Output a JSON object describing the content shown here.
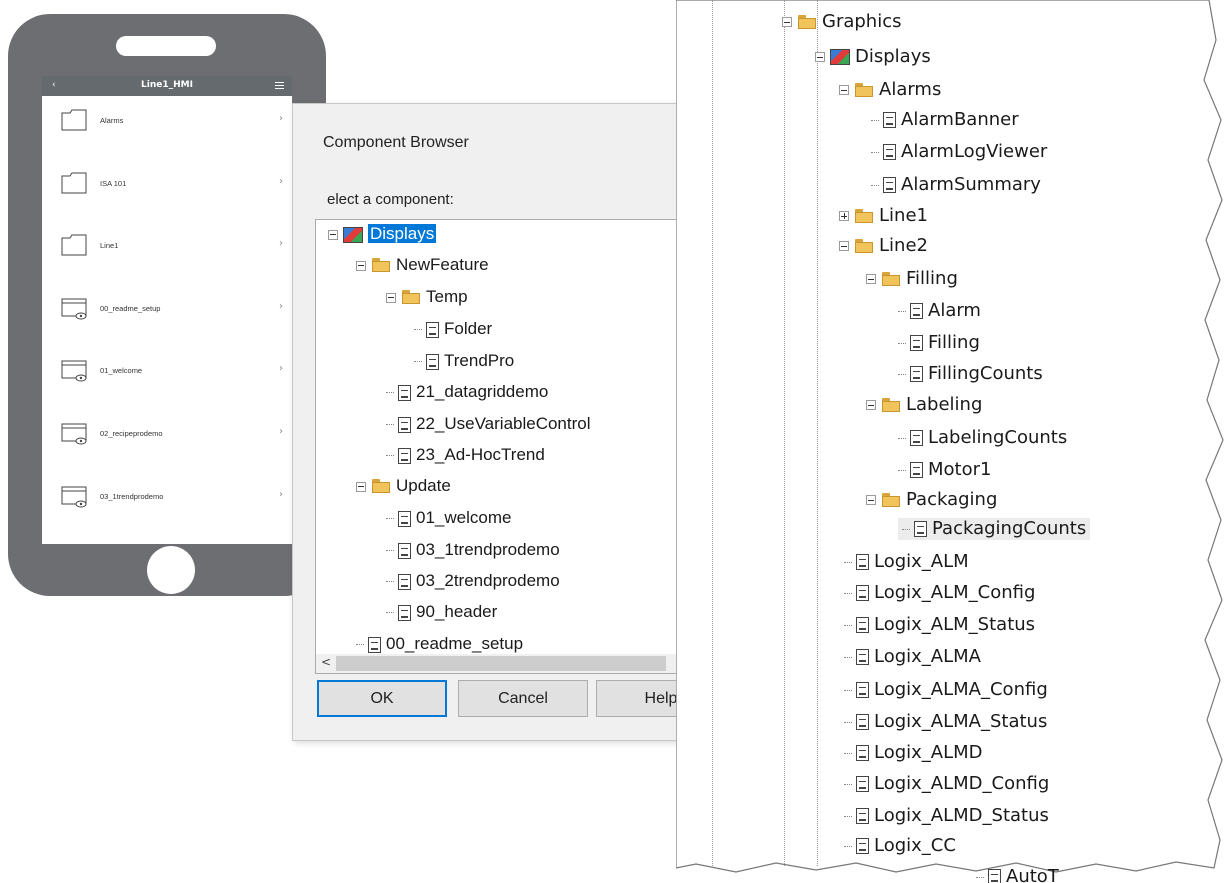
{
  "phone": {
    "back": "‹",
    "title": "Line1_HMI",
    "items": [
      {
        "label": "Alarms",
        "icon": "folder-icon"
      },
      {
        "label": "ISA 101",
        "icon": "folder-icon"
      },
      {
        "label": "Line1",
        "icon": "folder-icon"
      },
      {
        "label": "00_readme_setup",
        "icon": "display-icon"
      },
      {
        "label": "01_welcome",
        "icon": "display-icon"
      },
      {
        "label": "02_recipeprodemo",
        "icon": "display-icon"
      },
      {
        "label": "03_1trendprodemo",
        "icon": "display-icon"
      }
    ],
    "chevron": "›"
  },
  "dialog": {
    "title": "Component Browser",
    "close": "×",
    "prompt": "elect a component:",
    "tree": [
      {
        "label": "Displays",
        "type": "display",
        "expander": "minus",
        "selected": true
      },
      {
        "label": "NewFeature",
        "type": "folder",
        "expander": "minus"
      },
      {
        "label": "Temp",
        "type": "folder",
        "expander": "minus"
      },
      {
        "label": "Folder",
        "type": "doc"
      },
      {
        "label": "TrendPro",
        "type": "doc"
      },
      {
        "label": "21_datagriddemo",
        "type": "doc"
      },
      {
        "label": "22_UseVariableControl",
        "type": "doc"
      },
      {
        "label": "23_Ad-HocTrend",
        "type": "doc"
      },
      {
        "label": "Update",
        "type": "folder",
        "expander": "minus"
      },
      {
        "label": "01_welcome",
        "type": "doc"
      },
      {
        "label": "03_1trendprodemo",
        "type": "doc"
      },
      {
        "label": "03_2trendprodemo",
        "type": "doc"
      },
      {
        "label": "90_header",
        "type": "doc"
      },
      {
        "label": "00_readme_setup",
        "type": "doc"
      }
    ],
    "buttons": {
      "ok": "OK",
      "cancel": "Cancel",
      "help": "Help"
    },
    "scroll": {
      "up": "^",
      "down": "v",
      "left": "<",
      "right": ">"
    }
  },
  "right_tree": [
    {
      "label": "Graphics",
      "type": "folder",
      "expander": "minus"
    },
    {
      "label": "Displays",
      "type": "display",
      "expander": "minus"
    },
    {
      "label": "Alarms",
      "type": "folder",
      "expander": "minus"
    },
    {
      "label": "AlarmBanner",
      "type": "doc"
    },
    {
      "label": "AlarmLogViewer",
      "type": "doc"
    },
    {
      "label": "AlarmSummary",
      "type": "doc"
    },
    {
      "label": "Line1",
      "type": "folder",
      "expander": "plus"
    },
    {
      "label": "Line2",
      "type": "folder",
      "expander": "minus"
    },
    {
      "label": "Filling",
      "type": "folder",
      "expander": "minus"
    },
    {
      "label": "Alarm",
      "type": "doc"
    },
    {
      "label": "Filling",
      "type": "doc"
    },
    {
      "label": "FillingCounts",
      "type": "doc"
    },
    {
      "label": "Labeling",
      "type": "folder",
      "expander": "minus"
    },
    {
      "label": "LabelingCounts",
      "type": "doc"
    },
    {
      "label": "Motor1",
      "type": "doc"
    },
    {
      "label": "Packaging",
      "type": "folder",
      "expander": "minus"
    },
    {
      "label": "PackagingCounts",
      "type": "doc",
      "selected": true
    },
    {
      "label": "Logix_ALM",
      "type": "doc"
    },
    {
      "label": "Logix_ALM_Config",
      "type": "doc"
    },
    {
      "label": "Logix_ALM_Status",
      "type": "doc"
    },
    {
      "label": "Logix_ALMA",
      "type": "doc"
    },
    {
      "label": "Logix_ALMA_Config",
      "type": "doc"
    },
    {
      "label": "Logix_ALMA_Status",
      "type": "doc"
    },
    {
      "label": "Logix_ALMD",
      "type": "doc"
    },
    {
      "label": "Logix_ALMD_Config",
      "type": "doc"
    },
    {
      "label": "Logix_ALMD_Status",
      "type": "doc"
    },
    {
      "label": "Logix_CC",
      "type": "doc"
    },
    {
      "label": "AutoT",
      "type": "doc"
    }
  ]
}
